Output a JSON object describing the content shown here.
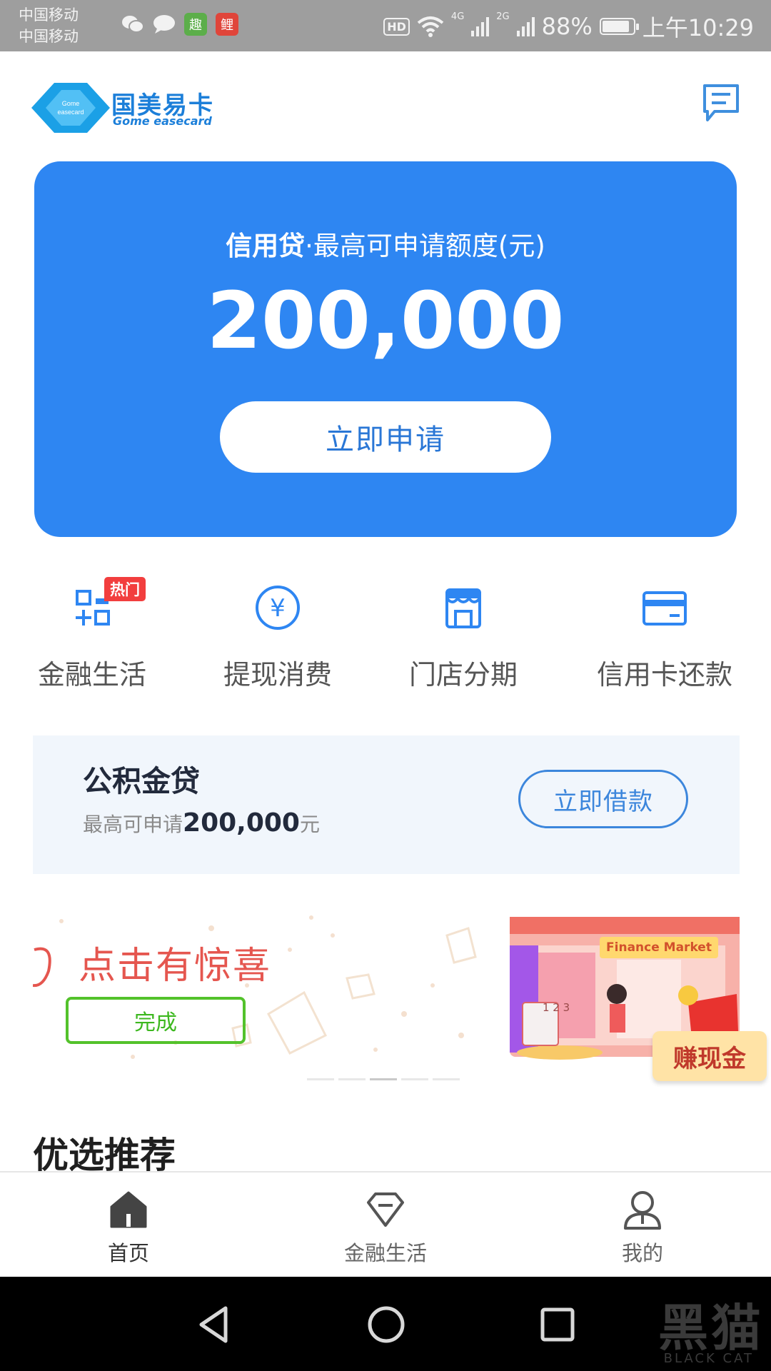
{
  "status_bar": {
    "carrier_1": "中国移动",
    "carrier_2": "中国移动",
    "hd": "HD",
    "net_1": "4G",
    "net_2": "2G",
    "battery_percent": "88%",
    "battery_level": 0.88,
    "time": "上午10:29",
    "apps": [
      {
        "icon": "wechat-icon"
      },
      {
        "icon": "message-icon"
      },
      {
        "icon": "app-green-icon",
        "text": "趣"
      },
      {
        "icon": "app-red-icon",
        "text": "鲤"
      }
    ]
  },
  "header": {
    "logo_cn": "国美易卡",
    "logo_en": "Gome easecard",
    "logo_mark_text": "Gome easecard",
    "message_icon": "message-list-icon"
  },
  "credit_card": {
    "title_bold": "信用贷",
    "title_rest": "·最高可申请额度(元)",
    "amount": "200,000",
    "apply_button": "立即申请",
    "background": "#2e86f2"
  },
  "quick_menu": [
    {
      "label": "金融生活",
      "icon": "grid-plus-icon",
      "badge": "热门"
    },
    {
      "label": "提现消费",
      "icon": "yuan-circle-icon"
    },
    {
      "label": "门店分期",
      "icon": "store-icon"
    },
    {
      "label": "信用卡还款",
      "icon": "credit-card-icon"
    }
  ],
  "fund_loan": {
    "title": "公积金贷",
    "sub_prefix": "最高可申请",
    "sub_amount": "200,000",
    "sub_unit": "元",
    "button": "立即借款"
  },
  "banner": {
    "text": "点击有惊喜",
    "done_button": "完成",
    "market_label": "Finance Market",
    "earn_label": "赚现金",
    "calc_digits": "1 2 3",
    "active_dot": 2
  },
  "section": {
    "title": "优选推荐"
  },
  "tab_bar": [
    {
      "label": "首页",
      "icon": "home-icon",
      "active": true
    },
    {
      "label": "金融生活",
      "icon": "diamond-icon",
      "active": false
    },
    {
      "label": "我的",
      "icon": "user-icon",
      "active": false
    }
  ],
  "nav_bar": {
    "watermark": "黑猫",
    "watermark_sub": "BLACK CAT"
  },
  "colors": {
    "accent": "#2e86f2",
    "badge": "#f23e3e",
    "done_green": "#53c22b",
    "banner_red": "#e5564f"
  }
}
